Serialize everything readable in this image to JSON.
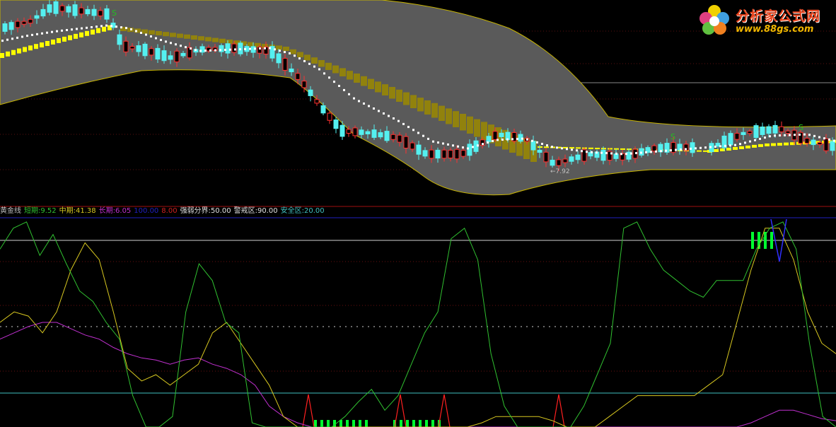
{
  "main_panel": {
    "low_marker": "←7.92",
    "signal_marks": [
      "S",
      "S",
      "S"
    ]
  },
  "indicator_legend": {
    "name": "黄金线",
    "short_label": "短期:",
    "short_value": "9.52",
    "mid_label": "中期:",
    "mid_value": "41.38",
    "long_label": "长期:",
    "long_value": "6.05",
    "extra1": "100.00",
    "extra2": "8.00",
    "strong_weak_label": "强弱分界:",
    "strong_weak_value": "50.00",
    "warning_label": "警戒区:",
    "warning_value": "90.00",
    "safe_label": "安全区:",
    "safe_value": "20.00"
  },
  "logo": {
    "title": "分析家公式网",
    "url": "www.88gs.com"
  },
  "colors": {
    "band_fill": "#5a5a5a",
    "band_edge": "#c8b400",
    "up_candle": "#ff3030",
    "down_candle": "#54f0f0",
    "white_dots": "#ffffff",
    "yellow_blocks": "#ffff00",
    "olive_blocks": "#9b8a00",
    "short_line": "#30c030",
    "mid_line": "#d8c820",
    "long_line": "#c030d0",
    "bar_green": "#00ff30",
    "spike_red": "#ff2020",
    "safe_line": "#40c0c0"
  },
  "chart_data": {
    "type": "line",
    "series": [
      {
        "name": "短期",
        "values": [
          85,
          95,
          98,
          82,
          92,
          78,
          65,
          60,
          50,
          42,
          15,
          0,
          0,
          5,
          55,
          78,
          70,
          50,
          45,
          2,
          0,
          0,
          0,
          0,
          0,
          0,
          5,
          12,
          18,
          8,
          15,
          30,
          45,
          55,
          90,
          95,
          80,
          35,
          10,
          0,
          0,
          0,
          0,
          0,
          10,
          25,
          40,
          95,
          98,
          85,
          75,
          70,
          65,
          62,
          70,
          70,
          70,
          85,
          95,
          98,
          85,
          40,
          5,
          0
        ]
      },
      {
        "name": "中期",
        "values": [
          50,
          55,
          53,
          45,
          55,
          75,
          88,
          80,
          55,
          28,
          22,
          25,
          20,
          25,
          30,
          45,
          50,
          40,
          30,
          20,
          5,
          0,
          0,
          0,
          0,
          0,
          0,
          0,
          0,
          0,
          0,
          0,
          0,
          0,
          2,
          5,
          5,
          5,
          5,
          3,
          0,
          0,
          0,
          5,
          10,
          15,
          15,
          15,
          15,
          15,
          20,
          25,
          50,
          75,
          95,
          95,
          80,
          55,
          40,
          35
        ]
      },
      {
        "name": "长期",
        "values": [
          42,
          45,
          48,
          50,
          50,
          47,
          44,
          42,
          38,
          35,
          33,
          32,
          30,
          32,
          33,
          30,
          28,
          25,
          20,
          10,
          5,
          2,
          0,
          0,
          0,
          0,
          0,
          0,
          0,
          0,
          0,
          0,
          0,
          0,
          0,
          0,
          0,
          0,
          0,
          0,
          0,
          0,
          0,
          0,
          0,
          0,
          0,
          0,
          0,
          0,
          0,
          0,
          0,
          2,
          5,
          8,
          8,
          6,
          4,
          3
        ]
      }
    ],
    "levels": [
      {
        "name": "警戒区",
        "value": 90
      },
      {
        "name": "强弱分界",
        "value": 50
      },
      {
        "name": "安全区",
        "value": 20
      }
    ],
    "ylim": [
      0,
      100
    ]
  }
}
